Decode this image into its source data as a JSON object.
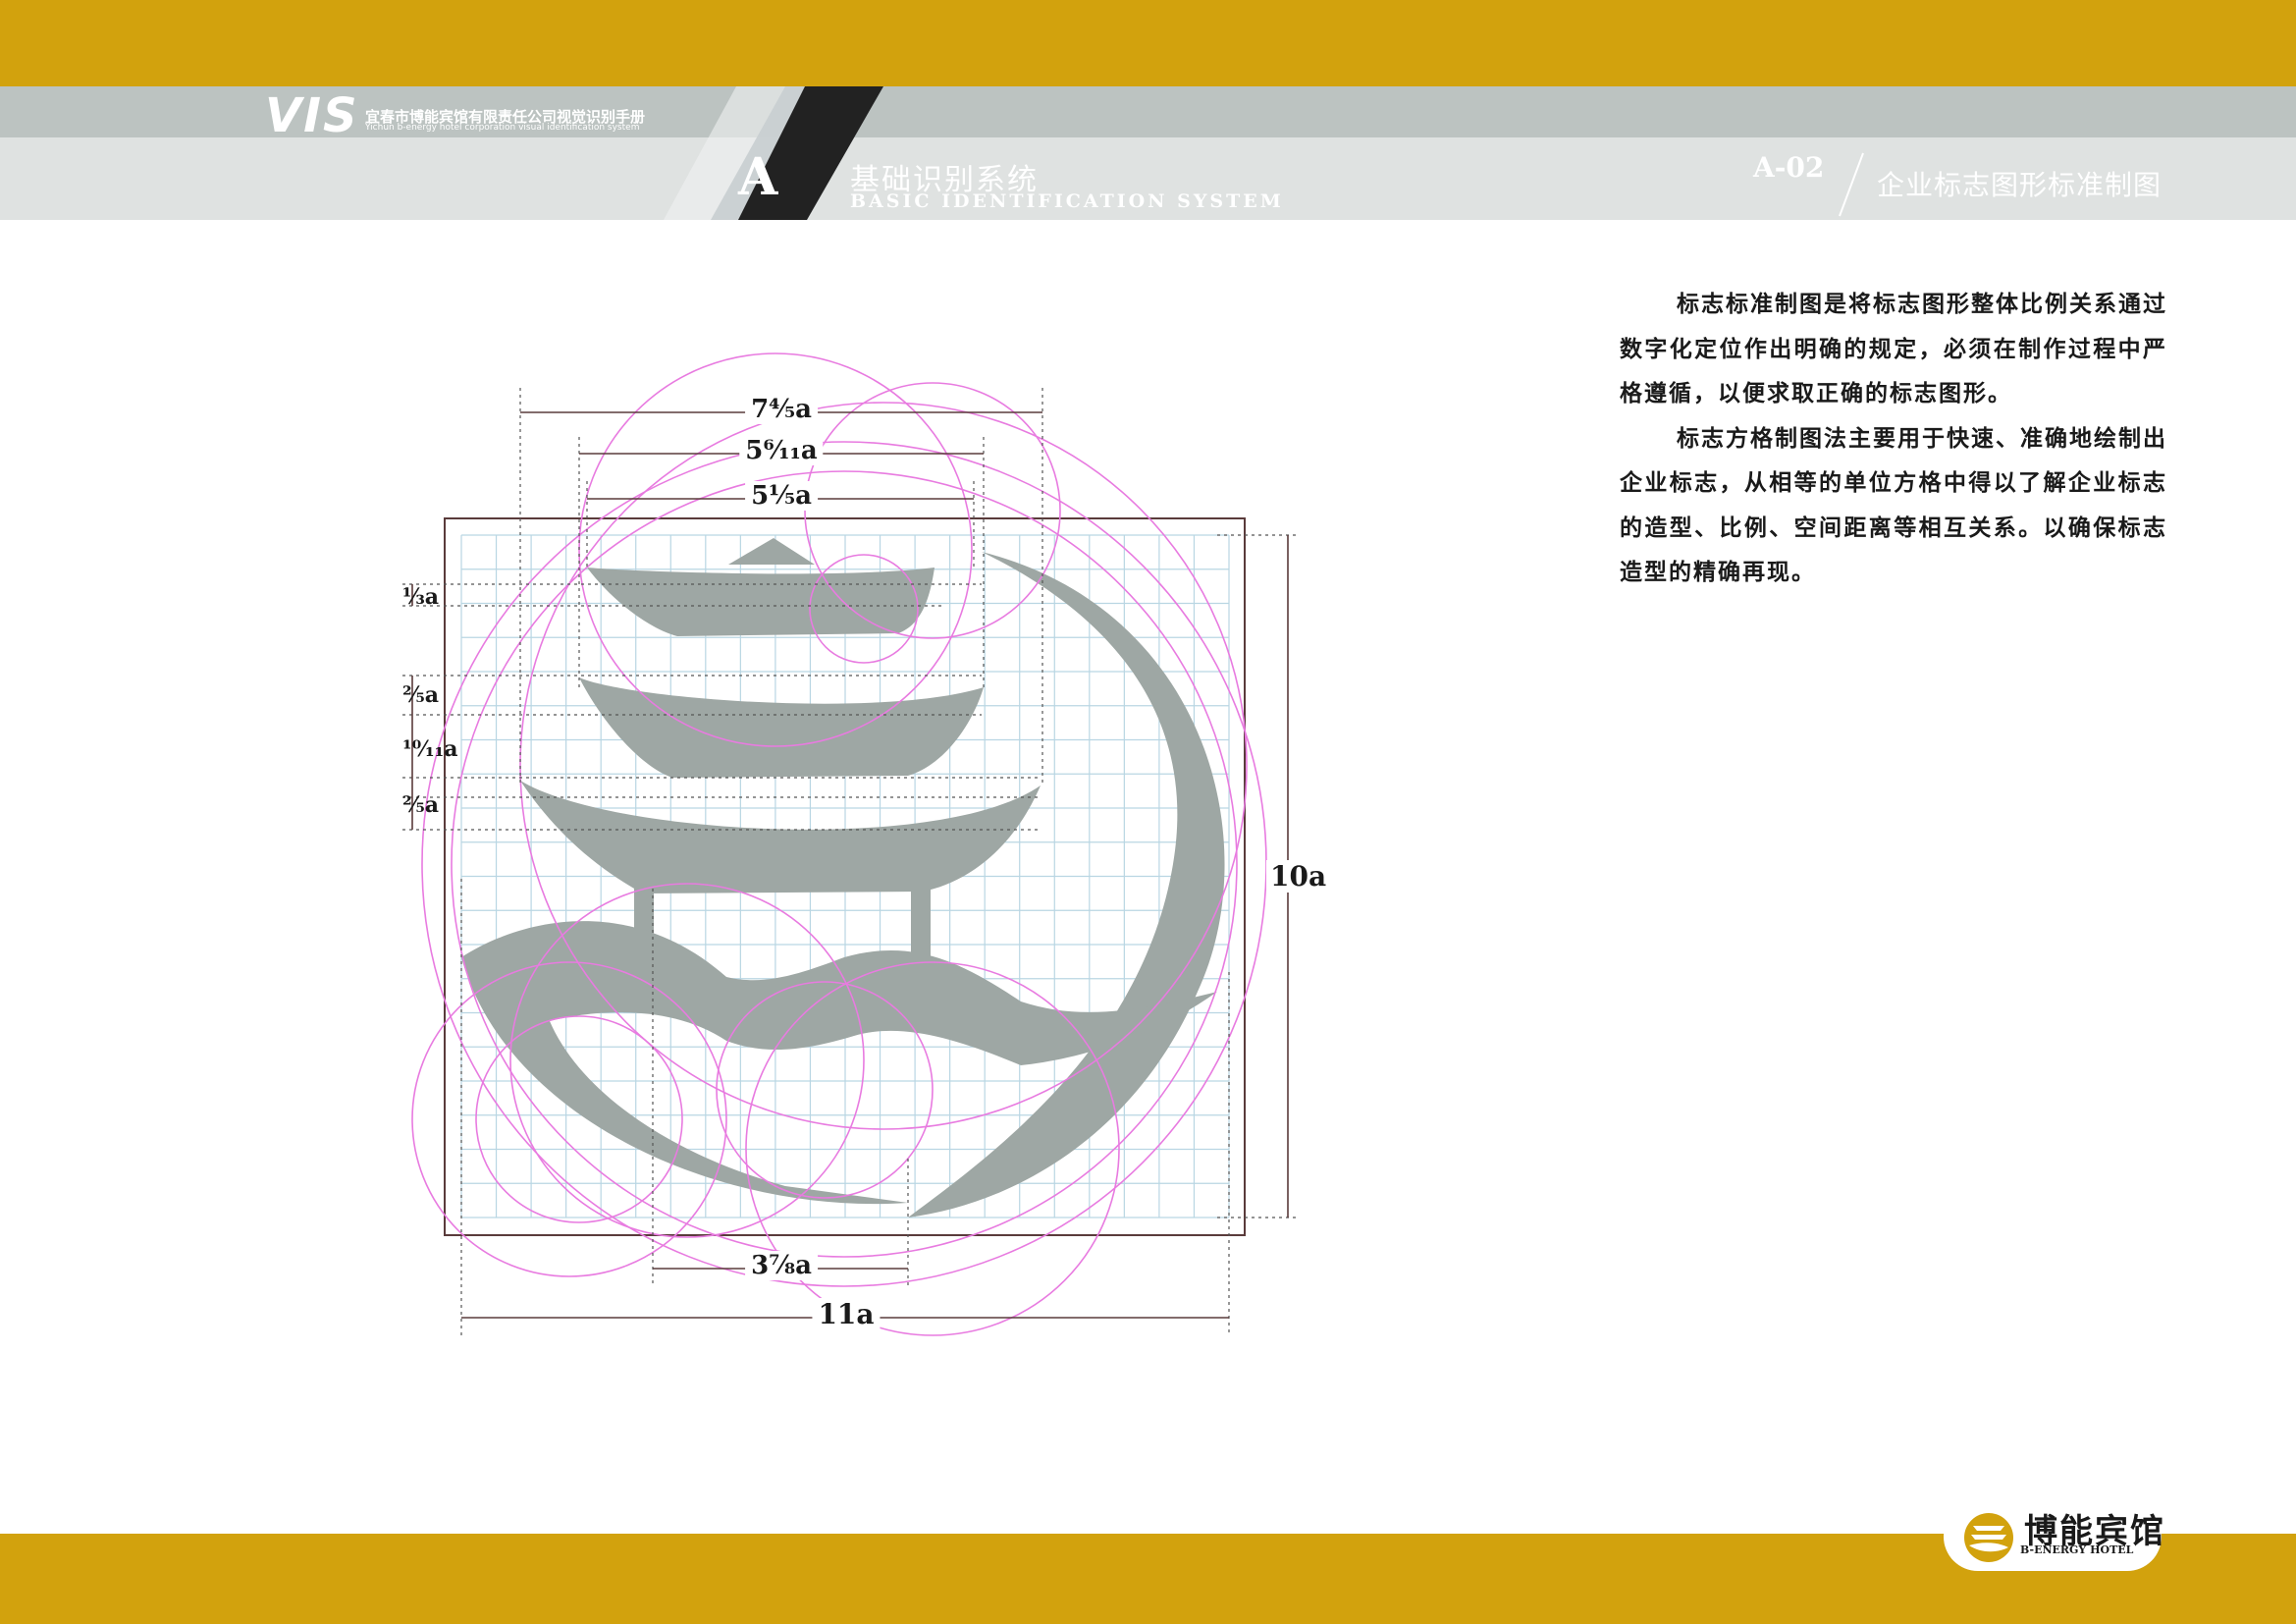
{
  "header": {
    "vis_mark": "VIS",
    "company_cn": "宜春市博能宾馆有限责任公司视觉识别手册",
    "company_en": "Yichun b-energy hotel corporation visual identification system",
    "section_letter": "A",
    "section_cn": "基础识别系统",
    "section_en": "BASIC IDENTIFICATION SYSTEM",
    "page_code": "A-02",
    "page_title": "企业标志图形标准制图"
  },
  "description": [
    "标志标准制图是将标志图形整体比例关系通过数字化定位作出明确的规定，必须在制作过程中严格遵循，以便求取正确的标志图形。",
    "标志方格制图法主要用于快速、准确地绘制出企业标志，从相等的单位方格中得以了解企业标志的造型、比例、空间距离等相互关系。以确保标志造型的精确再现。"
  ],
  "dimensions": {
    "top1": "7⅘a",
    "top2": "5⁶⁄₁₁a",
    "top3": "5⅕a",
    "left1": "⅓a",
    "left2": "⅖a",
    "left3": "¹⁰⁄₁₁a",
    "left4": "⅖a",
    "right": "10a",
    "bottom1": "3⅞a",
    "bottom2": "11a"
  },
  "colors": {
    "gold": "#d2a20d",
    "band_gray": "#dfe2e1",
    "logo_gray": "#9ea7a4",
    "guide_pink": "#e87be0",
    "grid_blue": "#b9d6e3"
  },
  "brand": {
    "name_cn": "博能宾馆",
    "name_en": "B-ENERGY HOTEL"
  }
}
